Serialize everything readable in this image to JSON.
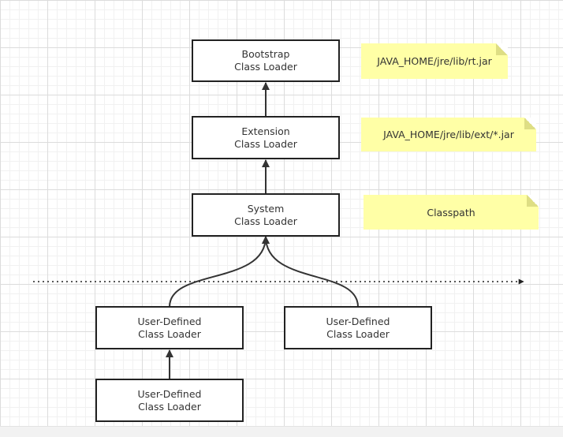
{
  "colors": {
    "line": "#222222",
    "note_fill": "#ffffa6",
    "note_fold": "#dede84",
    "grid_major": "#dcdcdc",
    "grid_minor": "#f1f1f1"
  },
  "nodes": {
    "bootstrap": {
      "line1": "Bootstrap",
      "line2": "Class Loader"
    },
    "extension": {
      "line1": "Extension",
      "line2": "Class Loader"
    },
    "system": {
      "line1": "System",
      "line2": "Class Loader"
    },
    "user_left": {
      "line1": "User-Defined",
      "line2": "Class Loader"
    },
    "user_right": {
      "line1": "User-Defined",
      "line2": "Class Loader"
    },
    "user_bottom": {
      "line1": "User-Defined",
      "line2": "Class Loader"
    }
  },
  "notes": {
    "bootstrap_path": "JAVA_HOME/jre/lib/rt.jar",
    "extension_path": "JAVA_HOME/jre/lib/ext/*.jar",
    "system_path": "Classpath"
  }
}
